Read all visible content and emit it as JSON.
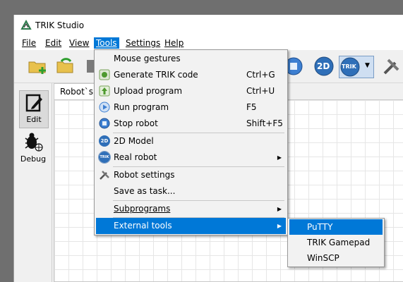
{
  "window": {
    "title": "TRIK Studio"
  },
  "menubar": {
    "file": "File",
    "edit": "Edit",
    "view": "View",
    "tools": "Tools",
    "settings": "Settings",
    "help": "Help"
  },
  "toolbar": {
    "model2d_badge": "2D",
    "trik_badge": "TRIK"
  },
  "sidebar": {
    "edit": "Edit",
    "debug": "Debug"
  },
  "tab": {
    "label": "Robot`s Behaviour"
  },
  "tools_menu": {
    "items": [
      {
        "label": "Mouse gestures",
        "shortcut": ""
      },
      {
        "label": "Generate TRIK code",
        "shortcut": "Ctrl+G"
      },
      {
        "label": "Upload program",
        "shortcut": "Ctrl+U"
      },
      {
        "label": "Run program",
        "shortcut": "F5"
      },
      {
        "label": "Stop robot",
        "shortcut": "Shift+F5"
      },
      {
        "label": "2D Model",
        "shortcut": ""
      },
      {
        "label": "Real robot",
        "shortcut": ""
      },
      {
        "label": "Robot settings",
        "shortcut": ""
      },
      {
        "label": "Save as task...",
        "shortcut": ""
      },
      {
        "label": "Subprograms",
        "shortcut": ""
      },
      {
        "label": "External tools",
        "shortcut": ""
      }
    ]
  },
  "external_tools_menu": {
    "items": [
      "PuTTY",
      "TRIK Gamepad",
      "WinSCP"
    ]
  },
  "colors": {
    "highlight": "#0078d7",
    "menu_bg": "#f2f2f2"
  }
}
